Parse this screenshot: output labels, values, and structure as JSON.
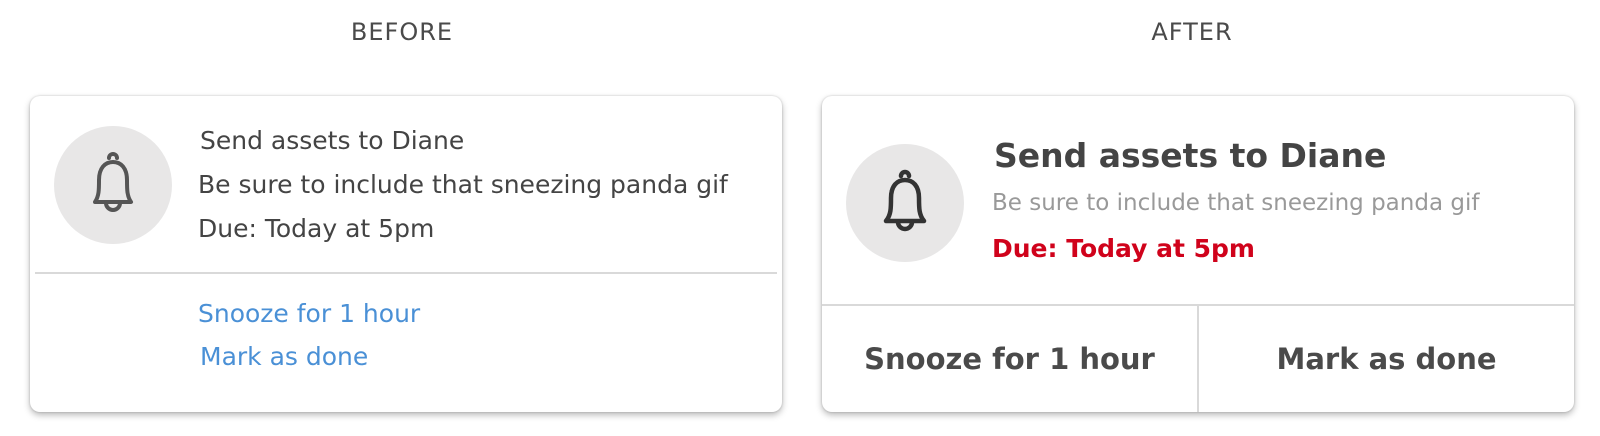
{
  "before": {
    "heading": "BEFORE",
    "title": "Send assets to Diane",
    "body": "Be sure to include that sneezing panda gif",
    "due": "Due: Today at 5pm",
    "actions": {
      "snooze": "Snooze for 1 hour",
      "done": "Mark as done"
    },
    "icon": "bell-icon"
  },
  "after": {
    "heading": "AFTER",
    "title": "Send assets to Diane",
    "body": "Be sure to include that sneezing panda gif",
    "due": "Due: Today at 5pm",
    "actions": {
      "snooze": "Snooze for 1 hour",
      "done": "Mark as done"
    },
    "icon": "bell-icon"
  },
  "colors": {
    "link_blue": "#4a90d6",
    "due_red": "#d0021b",
    "icon_bg": "#e8e7e7",
    "text_dark": "#444444",
    "text_muted": "#999999"
  }
}
